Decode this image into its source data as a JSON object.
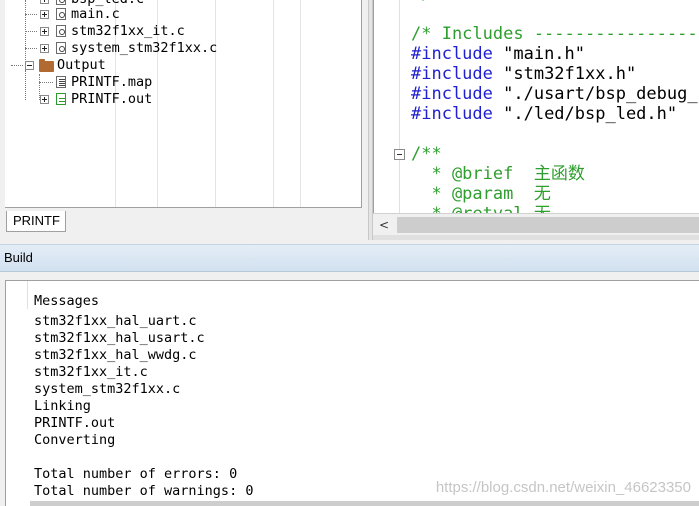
{
  "project_tree": {
    "items": [
      {
        "label": "bsp_led.c",
        "kind": "file"
      },
      {
        "label": "main.c",
        "kind": "file"
      },
      {
        "label": "stm32f1xx_it.c",
        "kind": "file"
      },
      {
        "label": "system_stm32f1xx.c",
        "kind": "file"
      },
      {
        "label": "Output",
        "kind": "folder"
      },
      {
        "label": "PRINTF.map",
        "kind": "map"
      },
      {
        "label": "PRINTF.out",
        "kind": "out"
      }
    ],
    "tab_label": "PRINTF"
  },
  "editor": {
    "lines": [
      {
        "text": "*/",
        "class": "c-comment"
      },
      {
        "text": "",
        "class": ""
      },
      {
        "text": "/* Includes ----------------------------",
        "class": "c-comment"
      },
      {
        "directive": "#include",
        "arg": " \"main.h\""
      },
      {
        "directive": "#include",
        "arg": " \"stm32f1xx.h\""
      },
      {
        "directive": "#include",
        "arg": " \"./usart/bsp_debug_usart.h\""
      },
      {
        "directive": "#include",
        "arg": " \"./led/bsp_led.h\""
      },
      {
        "text": "",
        "class": ""
      },
      {
        "text": "/**",
        "class": "c-comment"
      },
      {
        "text": "  * @brief  主函数",
        "class": "c-comment"
      },
      {
        "text": "  * @param  无",
        "class": "c-comment"
      },
      {
        "text": "  * @retval 无",
        "class": "c-comment"
      }
    ]
  },
  "build": {
    "title": "Build",
    "header": "Messages",
    "messages": [
      "stm32f1xx_hal_uart.c",
      "stm32f1xx_hal_usart.c",
      "stm32f1xx_hal_wwdg.c",
      "stm32f1xx_it.c",
      "system_stm32f1xx.c",
      "Linking",
      "PRINTF.out",
      "Converting",
      "",
      "Total number of errors: 0",
      "Total number of warnings: 0"
    ],
    "watermark": "https://blog.csdn.net/weixin_46623350"
  },
  "colors": {
    "comment": "#2e9e2e",
    "directive": "#2020d0",
    "build_header": "#d2e1ef"
  }
}
